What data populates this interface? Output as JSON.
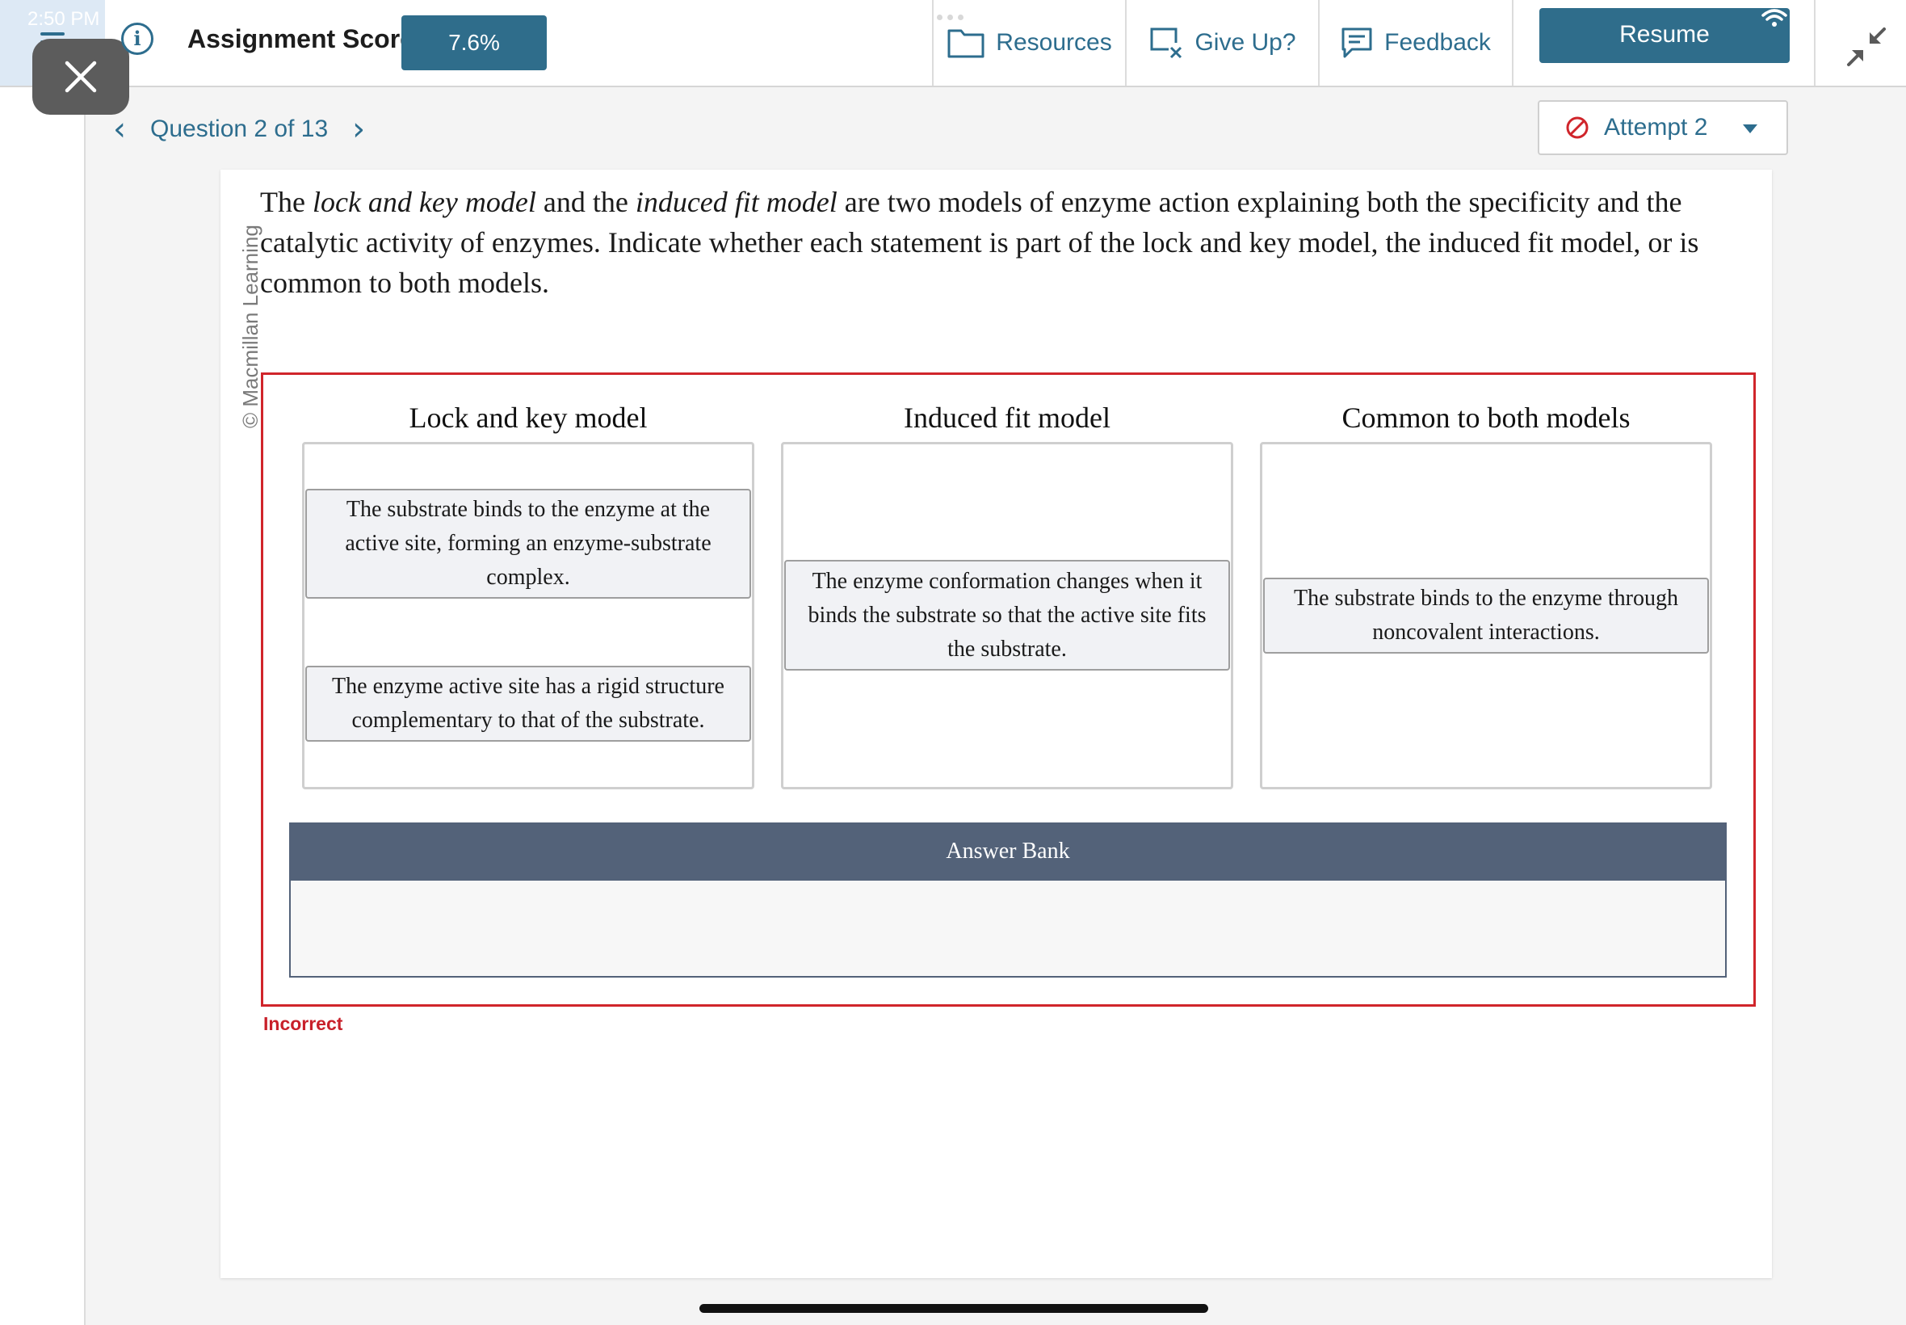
{
  "status_bar": {
    "time": "2:50 PM"
  },
  "header": {
    "score_label": "Assignment Score:",
    "score_value": "7.6%",
    "resources_label": "Resources",
    "give_up_label": "Give Up?",
    "feedback_label": "Feedback",
    "resume_label": "Resume"
  },
  "question_nav": {
    "label": "Question 2 of 13",
    "attempt_label": "Attempt 2"
  },
  "copyright": "© Macmillan Learning",
  "prompt": {
    "p1": "The ",
    "em1": "lock and key model",
    "p2": " and the ",
    "em2": "induced fit model",
    "p3": " are two models of enzyme action explaining both the specificity and the catalytic activity of enzymes. Indicate whether each statement is part of the lock and key model, the induced fit model, or is common to both models."
  },
  "bins": [
    {
      "title": "Lock and key model",
      "items": [
        "The substrate binds to the enzyme at the active site, forming an enzyme-substrate complex.",
        "The enzyme active site has a rigid structure complementary to that of the substrate."
      ]
    },
    {
      "title": "Induced fit model",
      "items": [
        "The enzyme conformation changes when it binds the substrate so that the active site fits the substrate."
      ]
    },
    {
      "title": "Common to both models",
      "items": [
        "The substrate binds to the enzyme through noncovalent interactions."
      ]
    }
  ],
  "answer_bank": {
    "title": "Answer Bank",
    "items": []
  },
  "result": {
    "status": "Incorrect"
  },
  "colors": {
    "accent": "#2f6d8b",
    "error": "#d0252b",
    "bank_header": "#536279"
  }
}
